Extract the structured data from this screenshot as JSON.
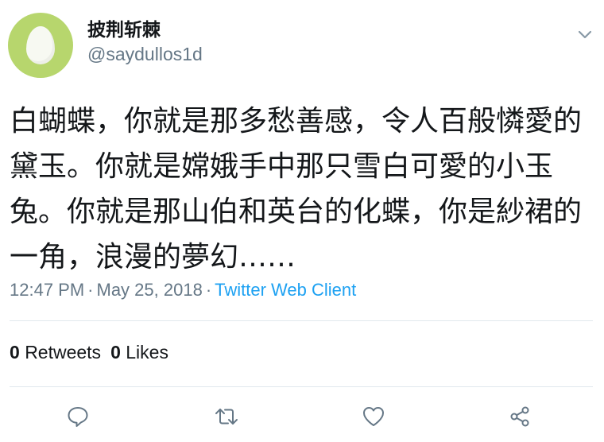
{
  "user": {
    "display_name": "披荆斩棘",
    "handle": "@saydullos1d"
  },
  "tweet": {
    "text": "白蝴蝶，你就是那多愁善感，令人百般憐愛的黛玉。你就是嫦娥手中那只雪白可愛的小玉兔。你就是那山伯和英台的化蝶，你是紗裙的一角，浪漫的夢幻……"
  },
  "meta": {
    "time": "12:47 PM",
    "date": "May 25, 2018",
    "separator": "·",
    "client": "Twitter Web Client"
  },
  "stats": {
    "retweets_count": "0",
    "retweets_label": "Retweets",
    "likes_count": "0",
    "likes_label": "Likes"
  },
  "icons": {
    "avatar": "default-egg-avatar",
    "caret": "chevron-down-icon",
    "reply": "reply-icon",
    "retweet": "retweet-icon",
    "like": "heart-icon",
    "share": "share-icon"
  },
  "colors": {
    "accent": "#1da1f2",
    "secondary_text": "#657786",
    "avatar_bg": "#b7d66d",
    "icon": "#657786"
  }
}
